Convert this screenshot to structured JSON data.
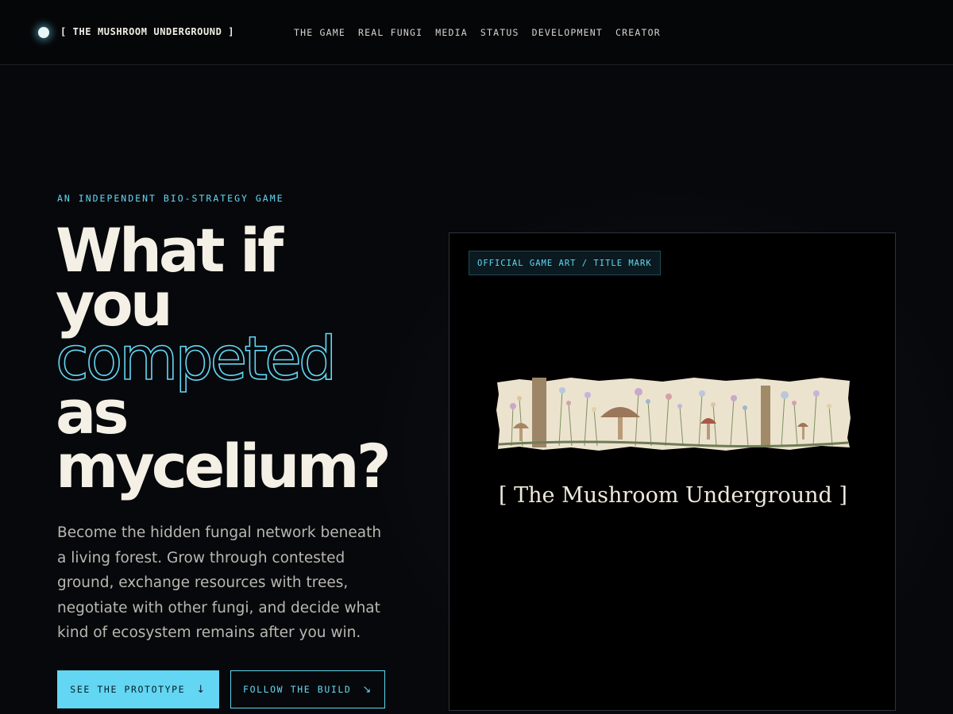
{
  "nav": {
    "brand": "[ THE MUSHROOM UNDERGROUND ]",
    "links": [
      "THE GAME",
      "REAL FUNGI",
      "MEDIA",
      "STATUS",
      "DEVELOPMENT",
      "CREATOR"
    ]
  },
  "hero": {
    "eyebrow": "AN INDEPENDENT BIO-STRATEGY GAME",
    "headline": [
      "What if",
      "you",
      "competed",
      "as",
      "mycelium?"
    ],
    "lede": "Become the hidden fungal network beneath a living forest. Grow through contested ground, exchange resources with trees, negotiate with other fungi, and decide what kind of ecosystem remains after you win.",
    "primary_button": "SEE THE PROTOTYPE",
    "primary_icon": "↓",
    "secondary_button": "FOLLOW THE BUILD",
    "secondary_icon": "↘"
  },
  "art": {
    "tag": "OFFICIAL GAME ART / TITLE MARK",
    "title": "[ The Mushroom Underground ]"
  },
  "colors": {
    "accent": "#63d6f3",
    "background": "#07080b",
    "text": "#f4f0e6",
    "paper": "#ece3cf"
  }
}
